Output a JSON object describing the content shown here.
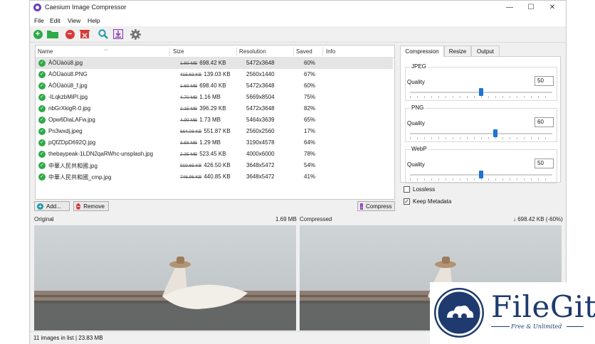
{
  "window": {
    "title": "Caesium Image Compressor",
    "controls": {
      "minimize": "—",
      "maximize": "☐",
      "close": "✕"
    }
  },
  "menu": [
    "File",
    "Edit",
    "View",
    "Help"
  ],
  "toolbar": {
    "icons": [
      "add-icon",
      "open-folder-icon",
      "remove-icon",
      "clear-list-icon",
      "preview-icon",
      "compress-icon",
      "settings-icon"
    ],
    "colors": {
      "green": "#2eaa48",
      "red": "#d83a3a",
      "teal": "#1b9aaa",
      "purple": "#8d3fb8",
      "gray": "#707070"
    }
  },
  "table": {
    "columns": [
      "Name",
      "Size",
      "Resolution",
      "Saved",
      "Info"
    ],
    "rows": [
      {
        "name": "ÀÒÜàòü8.jpg",
        "orig": "1.69 MB",
        "size": "698.42 KB",
        "res": "5472x3648",
        "saved": "60%"
      },
      {
        "name": "ÀÒÜàòü8.PNG",
        "orig": "415.63 KB",
        "size": "139.03 KB",
        "res": "2560x1440",
        "saved": "67%"
      },
      {
        "name": "ÀÒÜàòü8_f.jpg",
        "orig": "1.69 MB",
        "size": "698.40 KB",
        "res": "5472x3648",
        "saved": "60%"
      },
      {
        "name": "-ILqkzbMiPI.jpg",
        "orig": "4.70 MB",
        "size": "1.16 MB",
        "res": "5669x8504",
        "saved": "75%"
      },
      {
        "name": "nbGrXkigR-0.jpg",
        "orig": "2.15 MB",
        "size": "396.29 KB",
        "res": "5472x3648",
        "saved": "82%"
      },
      {
        "name": "Opw6DiaLAFw.jpg",
        "orig": "4.99 MB",
        "size": "1.73 MB",
        "res": "5464x3639",
        "saved": "65%"
      },
      {
        "name": "Pn3wxdj.jpeg",
        "orig": "664.08 KB",
        "size": "551.87 KB",
        "res": "2560x2560",
        "saved": "17%"
      },
      {
        "name": "pQfZDpD692Q.jpg",
        "orig": "3.58 MB",
        "size": "1.29 MB",
        "res": "3190x4578",
        "saved": "64%"
      },
      {
        "name": "thebaypeak-1LDN2qaRWhc-unsplash.jpg",
        "orig": "2.35 MB",
        "size": "523.45 KB",
        "res": "4000x6000",
        "saved": "78%"
      },
      {
        "name": "中華人民共和國.jpg",
        "orig": "919.65 KB",
        "size": "426.50 KB",
        "res": "3648x5472",
        "saved": "54%"
      },
      {
        "name": "中華人民共和國_cmp.jpg",
        "orig": "746.96 KB",
        "size": "440.85 KB",
        "res": "3648x5472",
        "saved": "41%"
      }
    ]
  },
  "buttons": {
    "add": "Add...",
    "remove": "Remove",
    "compress": "Compress"
  },
  "tabs": [
    "Compression",
    "Resize",
    "Output"
  ],
  "compression": {
    "jpeg": {
      "label": "JPEG",
      "quality_label": "Quality",
      "value": "50",
      "level": 0.5
    },
    "png": {
      "label": "PNG",
      "quality_label": "Quality",
      "value": "60",
      "level": 0.6
    },
    "webp": {
      "label": "WebP",
      "quality_label": "Quality",
      "value": "50",
      "level": 0.5
    },
    "lossless": {
      "label": "Lossless",
      "checked": false
    },
    "keep_metadata": {
      "label": "Keep Metadata",
      "checked": true
    }
  },
  "preview": {
    "original_label": "Original",
    "original_size": "1.69 MB",
    "compressed_label": "Compressed",
    "compressed_size": "↓ 698.42 KB (-60%)"
  },
  "status": "11 images in list | 23.83 MB",
  "watermark": {
    "title": "FileGit",
    "subtitle": "Free & Unlimited"
  }
}
